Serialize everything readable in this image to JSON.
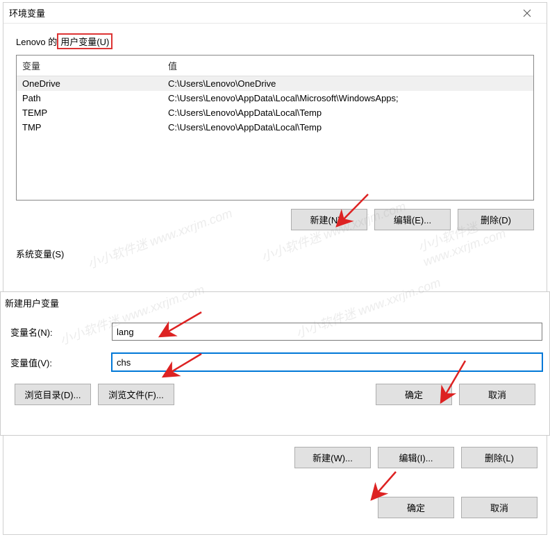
{
  "mainWindow": {
    "title": "环境变量",
    "userSection": {
      "labelPrefix": "Lenovo 的",
      "labelHighlight": "用户变量(U)",
      "columns": {
        "var": "变量",
        "val": "值"
      },
      "rows": [
        {
          "var": "OneDrive",
          "val": "C:\\Users\\Lenovo\\OneDrive"
        },
        {
          "var": "Path",
          "val": "C:\\Users\\Lenovo\\AppData\\Local\\Microsoft\\WindowsApps;"
        },
        {
          "var": "TEMP",
          "val": "C:\\Users\\Lenovo\\AppData\\Local\\Temp"
        },
        {
          "var": "TMP",
          "val": "C:\\Users\\Lenovo\\AppData\\Local\\Temp"
        }
      ],
      "buttons": {
        "new": "新建(N)...",
        "edit": "编辑(E)...",
        "delete": "删除(D)"
      }
    },
    "systemSection": {
      "label": "系统变量(S)"
    },
    "systemButtons": {
      "new": "新建(W)...",
      "edit": "编辑(I)...",
      "delete": "删除(L)"
    },
    "dialogButtons": {
      "ok": "确定",
      "cancel": "取消"
    }
  },
  "newVarWindow": {
    "title": "新建用户变量",
    "nameLabel": "变量名(N):",
    "nameValue": "lang",
    "valueLabel": "变量值(V):",
    "valueValue": "chs",
    "browseDir": "浏览目录(D)...",
    "browseFile": "浏览文件(F)...",
    "ok": "确定",
    "cancel": "取消"
  },
  "watermark": "小小软件迷 www.xxrjm.com"
}
